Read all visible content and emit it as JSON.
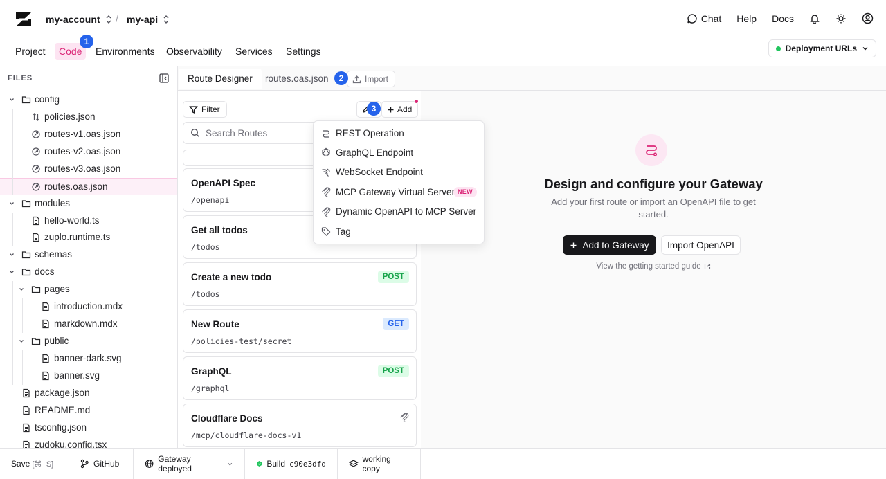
{
  "header": {
    "account": "my-account",
    "separator": "/",
    "project": "my-api",
    "chat": "Chat",
    "help": "Help",
    "docs": "Docs"
  },
  "nav": {
    "items": [
      "Project",
      "Code",
      "Environments",
      "Observability",
      "Services",
      "Settings"
    ],
    "active": "Code",
    "deploy_button": "Deployment URLs"
  },
  "badges": [
    "1",
    "2",
    "3"
  ],
  "sidebar": {
    "title": "FILES",
    "tree": [
      {
        "label": "config",
        "type": "folder",
        "depth": 0,
        "expanded": true
      },
      {
        "label": "policies.json",
        "type": "policy",
        "depth": 1
      },
      {
        "label": "routes-v1.oas.json",
        "type": "route",
        "depth": 1
      },
      {
        "label": "routes-v2.oas.json",
        "type": "route",
        "depth": 1
      },
      {
        "label": "routes-v3.oas.json",
        "type": "route",
        "depth": 1
      },
      {
        "label": "routes.oas.json",
        "type": "route",
        "depth": 1,
        "selected": true
      },
      {
        "label": "modules",
        "type": "folder",
        "depth": 0,
        "expanded": true
      },
      {
        "label": "hello-world.ts",
        "type": "file",
        "depth": 1
      },
      {
        "label": "zuplo.runtime.ts",
        "type": "file",
        "depth": 1
      },
      {
        "label": "schemas",
        "type": "folder",
        "depth": 0,
        "expanded": true
      },
      {
        "label": "docs",
        "type": "folder",
        "depth": 0,
        "expanded": true
      },
      {
        "label": "pages",
        "type": "folder",
        "depth": 1,
        "expanded": true
      },
      {
        "label": "introduction.mdx",
        "type": "file",
        "depth": 2
      },
      {
        "label": "markdown.mdx",
        "type": "file",
        "depth": 2
      },
      {
        "label": "public",
        "type": "folder",
        "depth": 1,
        "expanded": true
      },
      {
        "label": "banner-dark.svg",
        "type": "file",
        "depth": 2
      },
      {
        "label": "banner.svg",
        "type": "file",
        "depth": 2
      },
      {
        "label": "package.json",
        "type": "file",
        "depth": 0
      },
      {
        "label": "README.md",
        "type": "file",
        "depth": 0
      },
      {
        "label": "tsconfig.json",
        "type": "file",
        "depth": 0
      },
      {
        "label": "zudoku.config.tsx",
        "type": "file",
        "depth": 0
      }
    ]
  },
  "tabs": {
    "route_designer": "Route Designer",
    "file": "routes.oas.json",
    "import": "Import"
  },
  "routes_panel": {
    "filter": "Filter",
    "add": "Add",
    "search_placeholder": "Search Routes",
    "routes": [
      {
        "name": "OpenAPI Spec",
        "path": "/openapi",
        "method": ""
      },
      {
        "name": "Get all todos",
        "path": "/todos",
        "method": ""
      },
      {
        "name": "Create a new todo",
        "path": "/todos",
        "method": "POST"
      },
      {
        "name": "New Route",
        "path": "/policies-test/secret",
        "method": "GET"
      },
      {
        "name": "GraphQL",
        "path": "/graphql",
        "method": "POST"
      },
      {
        "name": "Cloudflare Docs",
        "path": "/mcp/cloudflare-docs-v1",
        "method": "",
        "icon": "mcp-icon"
      }
    ]
  },
  "add_menu": {
    "items": [
      {
        "label": "REST Operation",
        "icon": "rest-icon"
      },
      {
        "label": "GraphQL Endpoint",
        "icon": "graphql-icon"
      },
      {
        "label": "WebSocket Endpoint",
        "icon": "websocket-icon"
      },
      {
        "label": "MCP Gateway Virtual Server",
        "icon": "mcp-icon",
        "tag": "NEW"
      },
      {
        "label": "Dynamic OpenAPI to MCP Server",
        "icon": "mcp-icon"
      },
      {
        "label": "Tag",
        "icon": "tag-icon"
      }
    ]
  },
  "empty_state": {
    "title": "Design and configure your Gateway",
    "subtitle": "Add your first route or import an OpenAPI file to get started.",
    "primary": "Add to Gateway",
    "secondary": "Import OpenAPI",
    "guide": "View the getting started guide"
  },
  "statusbar": {
    "save": "Save",
    "save_shortcut": "[⌘+S]",
    "github": "GitHub",
    "gateway": "Gateway deployed",
    "build": "Build",
    "build_hash": "c90e3dfd",
    "working_copy": "working copy"
  },
  "colors": {
    "accent": "#db2777",
    "badge": "#2563eb",
    "post": "#16a34a",
    "get": "#2563eb"
  }
}
